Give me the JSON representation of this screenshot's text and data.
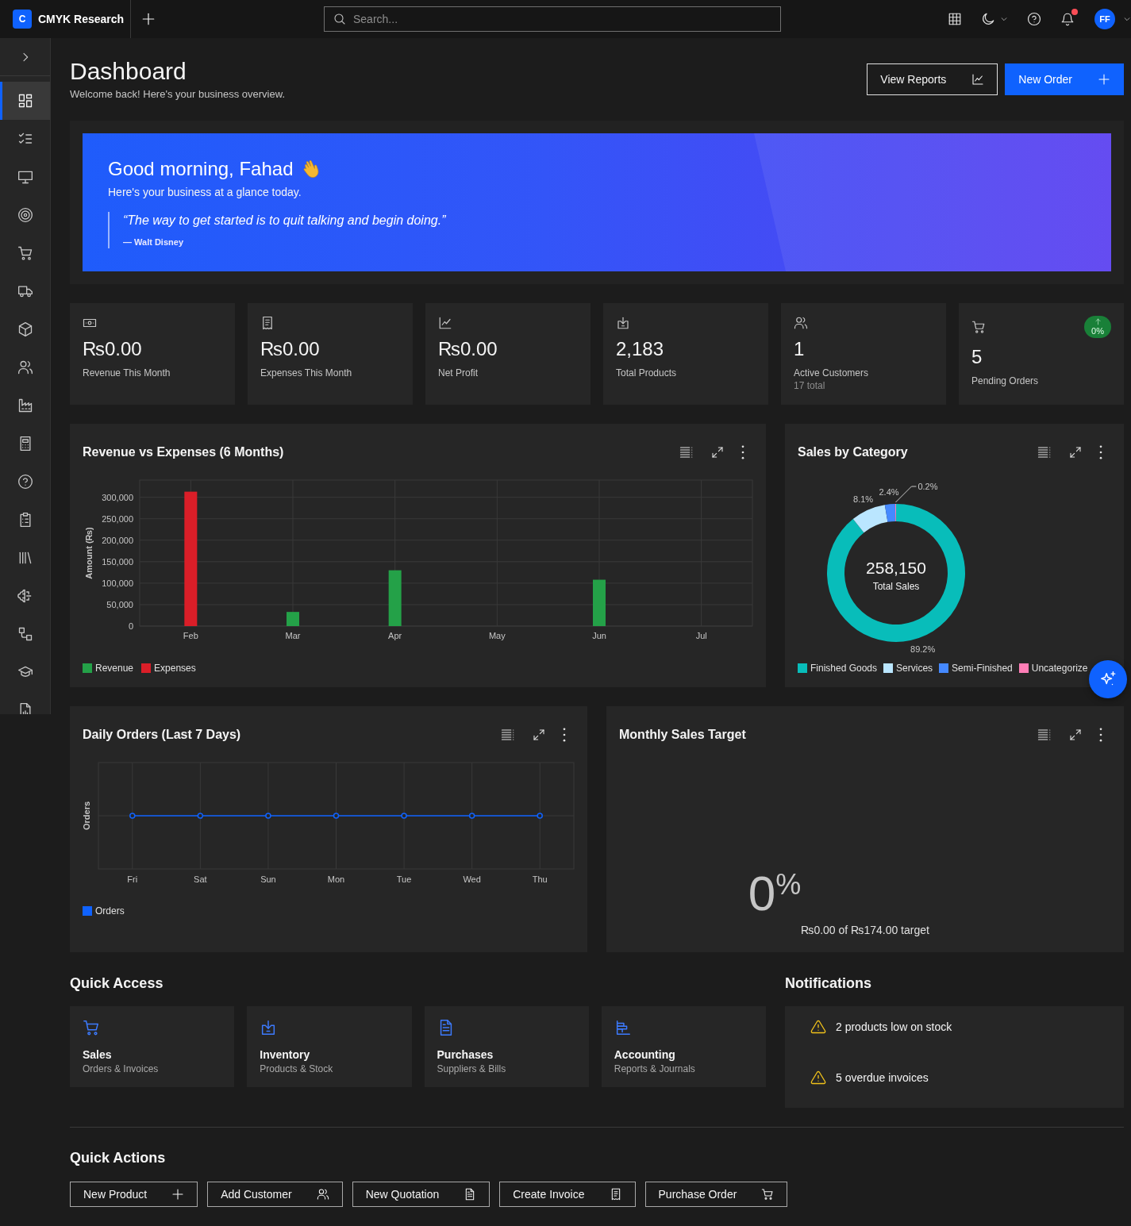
{
  "topbar": {
    "logo_letter": "C",
    "app_name": "CMYK Research",
    "search": {
      "placeholder": "Search..."
    },
    "has_unread_notifications": true,
    "avatar_initials": "FF"
  },
  "sidebar": {
    "items": [
      {
        "selected": true
      },
      {
        "selected": false
      },
      {
        "selected": false
      },
      {
        "selected": false
      },
      {
        "selected": false
      },
      {
        "selected": false
      },
      {
        "selected": false
      },
      {
        "selected": false
      },
      {
        "selected": false
      },
      {
        "selected": false
      },
      {
        "selected": false
      },
      {
        "selected": false
      },
      {
        "selected": false
      },
      {
        "selected": false
      },
      {
        "selected": false
      },
      {
        "selected": false
      },
      {
        "selected": false
      }
    ]
  },
  "header": {
    "title": "Dashboard",
    "subtitle": "Welcome back! Here's your business overview.",
    "buttons": [
      {
        "label": "View Reports",
        "kind": "secondary"
      },
      {
        "label": "New Order",
        "kind": "primary"
      }
    ]
  },
  "banner": {
    "greeting": "Good morning, Fahad",
    "subtitle": "Here's your business at a glance today.",
    "quote": "“The way to get started is to quit talking and begin doing.”",
    "author": "— Walt Disney"
  },
  "stats": [
    {
      "value": "₨0.00",
      "label": "Revenue This Month"
    },
    {
      "value": "₨0.00",
      "label": "Expenses This Month"
    },
    {
      "value": "₨0.00",
      "label": "Net Profit"
    },
    {
      "value": "2,183",
      "label": "Total Products"
    },
    {
      "value": "1",
      "label": "Active Customers",
      "note": "17 total"
    },
    {
      "value": "5",
      "label": "Pending Orders",
      "badge": "0%"
    }
  ],
  "revenue_chart": {
    "chart_data": {
      "type": "bar",
      "title": "Revenue vs Expenses (6 Months)",
      "ylabel": "Amount (₨)",
      "categories": [
        "Feb",
        "Mar",
        "Apr",
        "May",
        "Jun",
        "Jul"
      ],
      "series": [
        {
          "name": "Revenue",
          "color": "#24a148",
          "values": [
            null,
            33000,
            130000,
            null,
            108000,
            null
          ]
        },
        {
          "name": "Expenses",
          "color": "#da1e28",
          "values": [
            313000,
            null,
            null,
            null,
            null,
            null
          ]
        }
      ],
      "ylim": [
        0,
        340000
      ],
      "yticks": [
        {
          "value": 0,
          "label": "0"
        },
        {
          "value": 50000,
          "label": "50,000"
        },
        {
          "value": 100000,
          "label": "100,000"
        },
        {
          "value": 150000,
          "label": "150,000"
        },
        {
          "value": 200000,
          "label": "200,000"
        },
        {
          "value": 250000,
          "label": "250,000"
        },
        {
          "value": 300000,
          "label": "300,000"
        }
      ],
      "stacked": true,
      "grid": true,
      "legend": "bottom"
    }
  },
  "category_chart": {
    "center_value": "258,150",
    "center_label": "Total Sales",
    "chart_data": {
      "type": "donut",
      "title": "Sales by Category",
      "categories": [
        "Finished Goods",
        "Services",
        "Semi-Finished",
        "Uncategorize"
      ],
      "values": [
        89.2,
        8.1,
        2.4,
        0.2
      ],
      "colors": [
        "#08bdba",
        "#bae6ff",
        "#4589ff",
        "#ff7eb6"
      ],
      "value_labels": [
        "89.2%",
        "8.1%",
        "2.4%",
        "0.2%"
      ],
      "legend": "bottom"
    }
  },
  "daily_orders": {
    "title": "Daily Orders (Last 7 Days)",
    "ylabel": "Orders",
    "x_labels": [
      "Fri",
      "Sat",
      "Sun",
      "Mon",
      "Tue",
      "Wed",
      "Thu"
    ],
    "legend_label": "Orders"
  },
  "sales_target": {
    "title": "Monthly Sales Target",
    "value": "0$^{%}$",
    "caption": "₨0.00 of ₨174.00 target"
  },
  "quick_access": {
    "title": "Quick Access",
    "items": [
      {
        "title": "Sales",
        "subtitle": "Orders & Invoices"
      },
      {
        "title": "Inventory",
        "subtitle": "Products & Stock"
      },
      {
        "title": "Purchases",
        "subtitle": "Suppliers & Bills"
      },
      {
        "title": "Accounting",
        "subtitle": "Reports & Journals"
      }
    ]
  },
  "notifications": {
    "title": "Notifications",
    "items": [
      "2 products low on stock",
      "5 overdue invoices"
    ]
  },
  "quick_actions": {
    "title": "Quick Actions",
    "buttons": [
      "New Product",
      "Add Customer",
      "New Quotation",
      "Create Invoice",
      "Purchase Order"
    ]
  }
}
